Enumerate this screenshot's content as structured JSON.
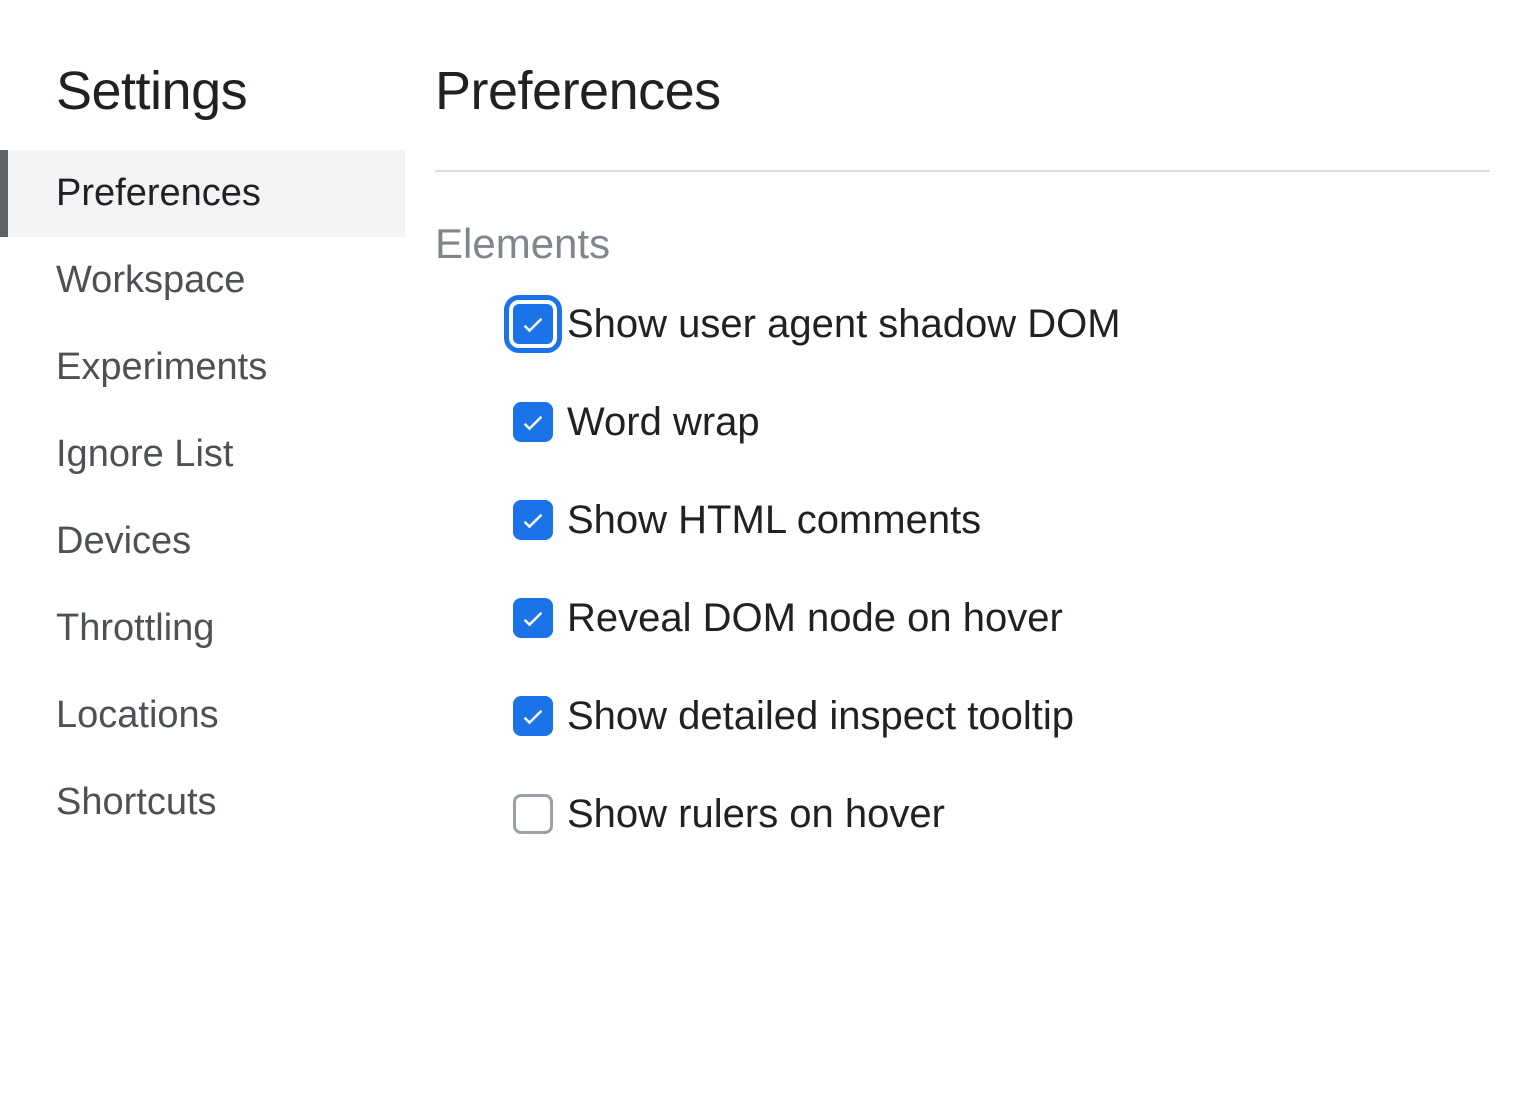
{
  "sidebar": {
    "title": "Settings",
    "items": [
      {
        "label": "Preferences",
        "active": true
      },
      {
        "label": "Workspace",
        "active": false
      },
      {
        "label": "Experiments",
        "active": false
      },
      {
        "label": "Ignore List",
        "active": false
      },
      {
        "label": "Devices",
        "active": false
      },
      {
        "label": "Throttling",
        "active": false
      },
      {
        "label": "Locations",
        "active": false
      },
      {
        "label": "Shortcuts",
        "active": false
      }
    ]
  },
  "main": {
    "title": "Preferences",
    "section": "Elements",
    "options": [
      {
        "label": "Show user agent shadow DOM",
        "checked": true,
        "focused": true
      },
      {
        "label": "Word wrap",
        "checked": true,
        "focused": false
      },
      {
        "label": "Show HTML comments",
        "checked": true,
        "focused": false
      },
      {
        "label": "Reveal DOM node on hover",
        "checked": true,
        "focused": false
      },
      {
        "label": "Show detailed inspect tooltip",
        "checked": true,
        "focused": false
      },
      {
        "label": "Show rulers on hover",
        "checked": false,
        "focused": false
      }
    ]
  }
}
